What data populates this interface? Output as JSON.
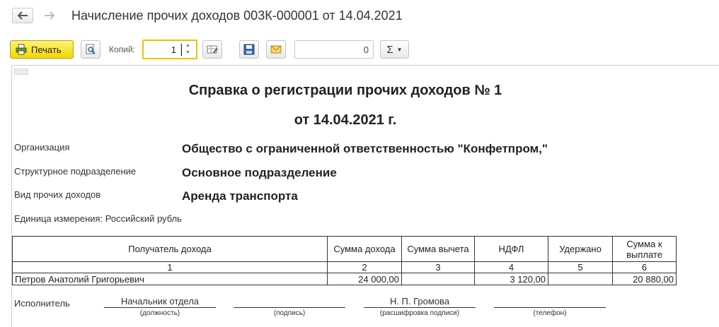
{
  "window": {
    "title": "Начисление прочих доходов 003К-000001 от 14.04.2021"
  },
  "toolbar": {
    "print_label": "Печать",
    "copies_label": "Копий:",
    "copies_value": "1",
    "number_value": "0",
    "sum_symbol": "Σ"
  },
  "document": {
    "title_line1": "Справка о регистрации прочих доходов № 1",
    "title_line2": "от 14.04.2021 г.",
    "fields": [
      {
        "label": "Организация",
        "value": "Общество с ограниченной ответственностью \"Конфетпром,\""
      },
      {
        "label": "Структурное подразделение",
        "value": "Основное подразделение"
      },
      {
        "label": "Вид прочих доходов",
        "value": "Аренда транспорта"
      }
    ],
    "unit_line": "Единица измерения: Российский рубль",
    "table": {
      "headers": [
        "Получатель дохода",
        "Сумма дохода",
        "Сумма вычета",
        "НДФЛ",
        "Удержано",
        "Сумма к выплате"
      ],
      "numbers": [
        "1",
        "2",
        "3",
        "4",
        "5",
        "6"
      ],
      "rows": [
        [
          "Петров Анатолий Григорьевич",
          "24 000,00",
          "",
          "3 120,00",
          "",
          "20 880,00"
        ]
      ]
    },
    "signature": {
      "label": "Исполнитель",
      "position_value": "Начальник отдела",
      "position_caption": "(должность)",
      "sign_value": "",
      "sign_caption": "(подпись)",
      "name_value": "Н. П. Громова",
      "name_caption": "(расшифровка подписи)",
      "phone_value": "",
      "phone_caption": "(телефон)"
    }
  }
}
